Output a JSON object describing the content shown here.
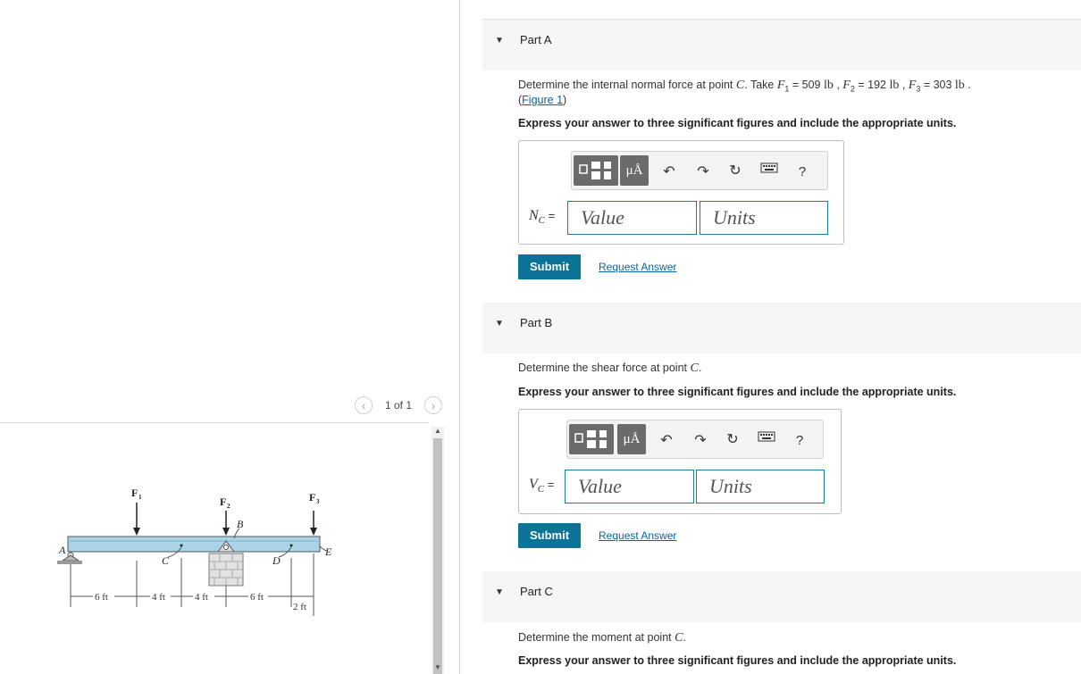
{
  "figure": {
    "pager": "1 of 1",
    "prev_icon": "chevron-left-icon",
    "next_icon": "chevron-right-icon",
    "labels": {
      "A": "A",
      "B": "B",
      "C": "C",
      "D": "D",
      "E": "E",
      "F1": "F",
      "F1_sub": "1",
      "F2": "F",
      "F2_sub": "2",
      "F3": "F",
      "F3_sub": "3"
    },
    "dimensions": [
      "6 ft",
      "4 ft",
      "4 ft",
      "6 ft",
      "2 ft"
    ]
  },
  "parts": [
    {
      "title": "Part A",
      "question_prefix": "Determine the internal normal force at point ",
      "point": "C",
      "question_mid": ". Take ",
      "F1_sym": "F",
      "F1_sub": "1",
      "F1_val": " = 509 ",
      "F1_unit": "lb",
      "F2_sym": "F",
      "F2_sub": "2",
      "F2_val": " = 192 ",
      "F2_unit": "lb",
      "F3_sym": "F",
      "F3_sub": "3",
      "F3_val": " = 303 ",
      "F3_unit": "lb",
      "sep": " , ",
      "end": " .",
      "figure_link_open": "(",
      "figure_link": "Figure 1",
      "figure_link_close": ")",
      "instruction": "Express your answer to three significant figures and include the appropriate units.",
      "var_label": "N",
      "var_sub": "C",
      "equals": " =",
      "value_placeholder": "Value",
      "units_placeholder": "Units",
      "submit": "Submit",
      "request": "Request Answer"
    },
    {
      "title": "Part B",
      "question_prefix": "Determine the shear force at point ",
      "point": "C",
      "question_end": ".",
      "instruction": "Express your answer to three significant figures and include the appropriate units.",
      "var_label": "V",
      "var_sub": "C",
      "equals": " =",
      "value_placeholder": "Value",
      "units_placeholder": "Units",
      "submit": "Submit",
      "request": "Request Answer"
    },
    {
      "title": "Part C",
      "question_prefix": "Determine the moment at point ",
      "point": "C",
      "question_end": ".",
      "instruction": "Express your answer to three significant figures and include the appropriate units."
    }
  ],
  "toolbar": {
    "units_tool": "μÅ",
    "help": "?",
    "icons": [
      "templates-icon",
      "units-icon",
      "undo-icon",
      "redo-icon",
      "reset-icon",
      "keyboard-icon",
      "help-icon"
    ]
  },
  "colors": {
    "submit": "#0b7396",
    "link": "#0a64a0",
    "beam": "#a9d3e6",
    "field_border": "#1d7a9a"
  }
}
